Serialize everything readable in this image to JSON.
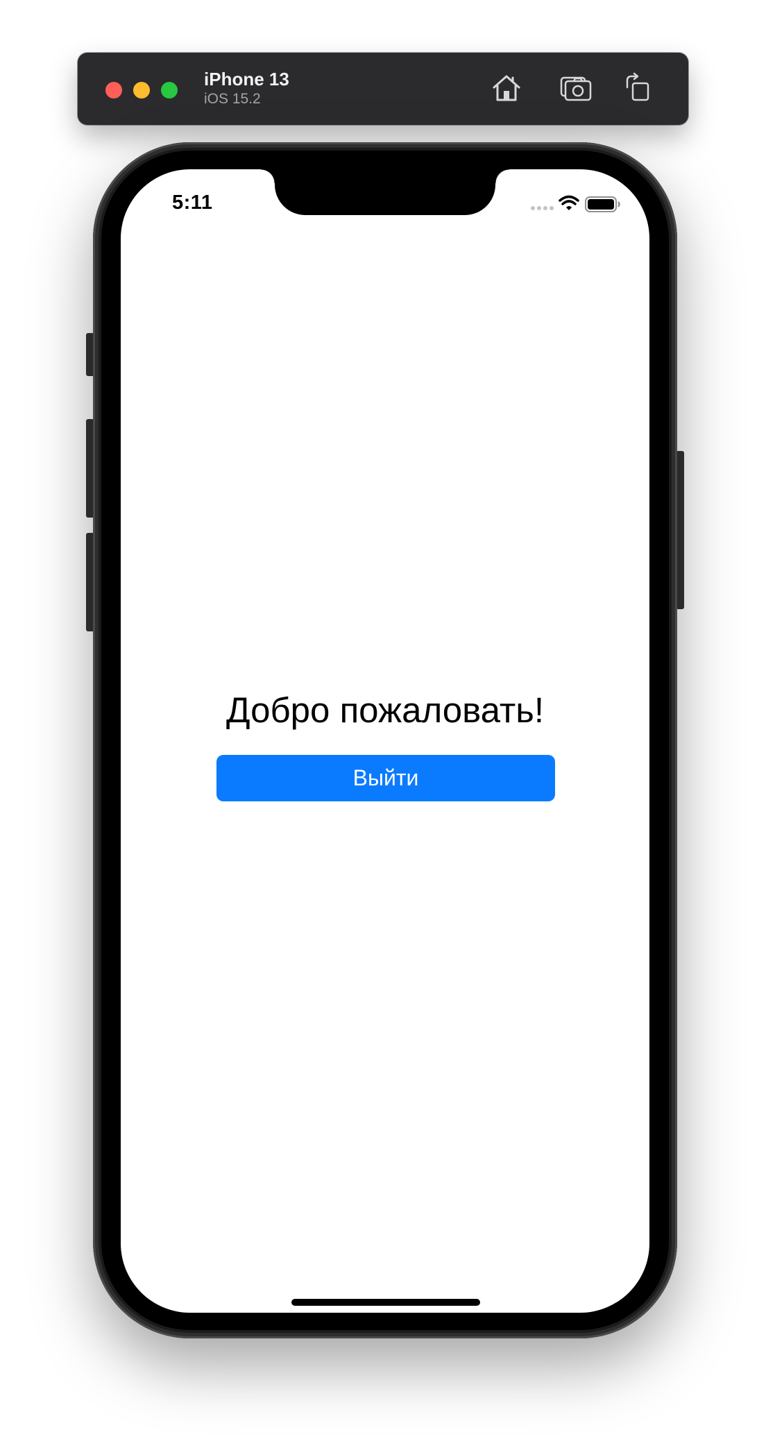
{
  "simulator": {
    "device_name": "iPhone 13",
    "os_version": "iOS 15.2",
    "toolbar": {
      "home_icon": "home-icon",
      "screenshot_icon": "camera-icon",
      "rotate_icon": "rotate-icon"
    },
    "traffic_lights": {
      "close_color": "#ff5f57",
      "minimize_color": "#febc2e",
      "maximize_color": "#28c840"
    }
  },
  "status_bar": {
    "time": "5:11",
    "icons": [
      "signal-dots-icon",
      "wifi-icon",
      "battery-icon"
    ]
  },
  "app": {
    "welcome_text": "Добро пожаловать!",
    "logout_label": "Выйти",
    "accent_color": "#0a7bff"
  }
}
